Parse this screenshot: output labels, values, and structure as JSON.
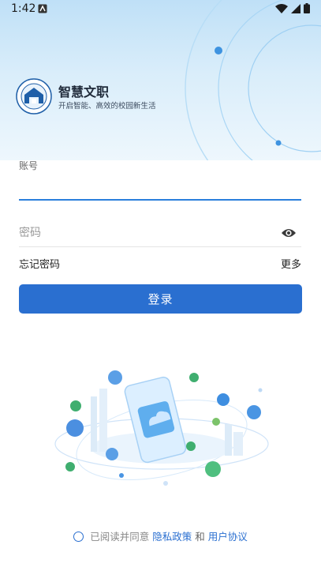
{
  "status_bar": {
    "time": "1:42"
  },
  "brand": {
    "title": "智慧文职",
    "subtitle": "开启智能、高效的校园新生活"
  },
  "form": {
    "account_label": "账号",
    "account_value": "",
    "password_placeholder": "密码",
    "forgot_label": "忘记密码",
    "more_label": "更多",
    "login_label": "登录"
  },
  "agreement": {
    "prefix": "已阅读并同意",
    "privacy_link": "隐私政策",
    "and": "和",
    "terms_link": "用户协议"
  },
  "colors": {
    "accent": "#2a6fd0",
    "hero_top": "#bfe0f7"
  },
  "icons": {
    "wifi": "wifi-icon",
    "signal": "signal-icon",
    "battery": "battery-icon",
    "eye": "eye-icon",
    "radio": "radio-unchecked-icon"
  }
}
